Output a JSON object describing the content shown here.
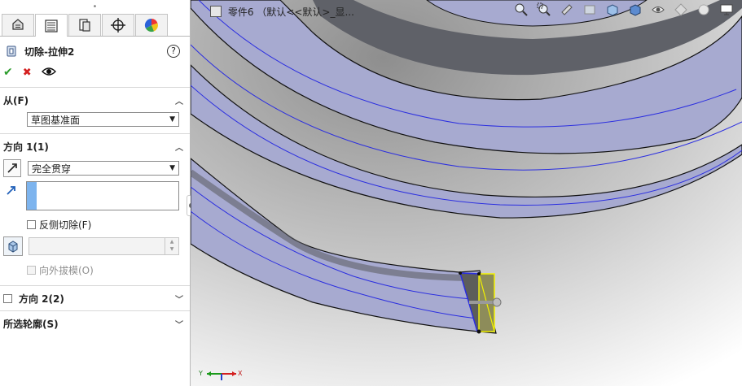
{
  "panel": {
    "grip": "•",
    "tabs": [
      {
        "icon": "feature-manager-icon"
      },
      {
        "icon": "property-manager-icon"
      },
      {
        "icon": "configuration-manager-icon"
      },
      {
        "icon": "dimxpert-icon"
      },
      {
        "icon": "display-manager-icon"
      }
    ],
    "feature_title": "切除-拉伸2",
    "help": "?",
    "actions": {
      "ok": "✔",
      "cancel": "✖",
      "preview": "👁"
    },
    "from": {
      "header": "从(F)",
      "value": "草图基准面"
    },
    "direction1": {
      "header": "方向 1(1)",
      "end_condition": "完全贯穿",
      "flip_side_cut": "反侧切除(F)",
      "draft_outward": "向外拔模(O)"
    },
    "direction2": {
      "header": "方向 2(2)"
    },
    "selected_contours": {
      "header": "所选轮廓(S)"
    }
  },
  "viewport": {
    "doc_title": "零件6 （默认<<默认>_显...",
    "triad": {
      "x": "X",
      "y": "Y"
    },
    "colors": {
      "solid_face": "#a7aad0",
      "solid_dark": "#5f6168",
      "edge_line": "#2b2ee0",
      "background_top": "#9b9b9b",
      "background_bottom": "#ffffff",
      "sketch_fill": "#8d8c5a",
      "sketch_outline": "#f1f100"
    }
  }
}
